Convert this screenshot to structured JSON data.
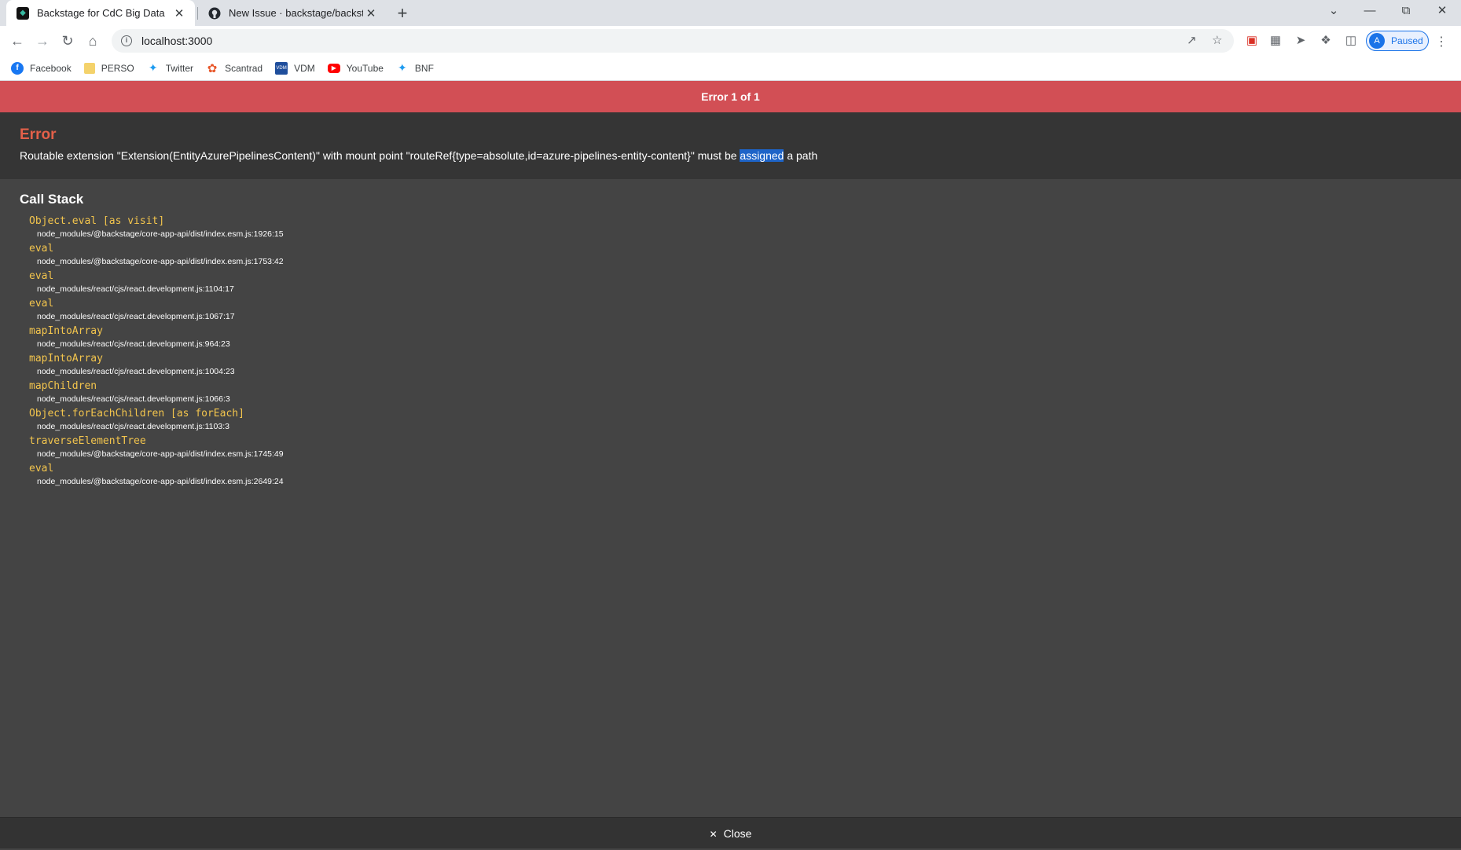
{
  "browser": {
    "tabs": [
      {
        "title": "Backstage for CdC Big Data",
        "favicon": "backstage-icon",
        "active": true
      },
      {
        "title": "New Issue · backstage/backstage",
        "favicon": "github-icon",
        "active": false
      }
    ],
    "address": "localhost:3000",
    "profile": {
      "initial": "A",
      "status": "Paused"
    },
    "bookmarks": [
      {
        "label": "Facebook",
        "icon": "facebook-icon",
        "color": "#1877f2"
      },
      {
        "label": "PERSO",
        "icon": "folder-icon",
        "color": "#f4d26b"
      },
      {
        "label": "Twitter",
        "icon": "twitter-icon",
        "color": "#1d9bf0"
      },
      {
        "label": "Scantrad",
        "icon": "scantrad-icon",
        "color": "#e8572a"
      },
      {
        "label": "VDM",
        "icon": "vdm-icon",
        "color": "#1f4e9c"
      },
      {
        "label": "YouTube",
        "icon": "youtube-icon",
        "color": "#ff0000"
      },
      {
        "label": "BNF",
        "icon": "twitter-icon",
        "color": "#1d9bf0"
      }
    ]
  },
  "overlay": {
    "header": "Error 1 of 1",
    "error_title": "Error",
    "message_before": "Routable extension \"Extension(EntityAzurePipelinesContent)\" with mount point \"routeRef{type=absolute,id=azure-pipelines-entity-content}\" must be ",
    "message_selected": "assigned",
    "message_after": " a path",
    "call_stack_title": "Call Stack",
    "frames": [
      {
        "fn": "Object.eval [as visit]",
        "loc": "node_modules/@backstage/core-app-api/dist/index.esm.js:1926:15"
      },
      {
        "fn": "eval",
        "loc": "node_modules/@backstage/core-app-api/dist/index.esm.js:1753:42"
      },
      {
        "fn": "eval",
        "loc": "node_modules/react/cjs/react.development.js:1104:17"
      },
      {
        "fn": "eval",
        "loc": "node_modules/react/cjs/react.development.js:1067:17"
      },
      {
        "fn": "mapIntoArray",
        "loc": "node_modules/react/cjs/react.development.js:964:23"
      },
      {
        "fn": "mapIntoArray",
        "loc": "node_modules/react/cjs/react.development.js:1004:23"
      },
      {
        "fn": "mapChildren",
        "loc": "node_modules/react/cjs/react.development.js:1066:3"
      },
      {
        "fn": "Object.forEachChildren [as forEach]",
        "loc": "node_modules/react/cjs/react.development.js:1103:3"
      },
      {
        "fn": "traverseElementTree",
        "loc": "node_modules/@backstage/core-app-api/dist/index.esm.js:1745:49"
      },
      {
        "fn": "eval",
        "loc": "node_modules/@backstage/core-app-api/dist/index.esm.js:2649:24"
      }
    ],
    "close_label": "Close"
  },
  "colors": {
    "header_red": "#d24f55",
    "error_title": "#e36049",
    "function_yellow": "#f3c54d",
    "overlay_bg": "#444444"
  }
}
